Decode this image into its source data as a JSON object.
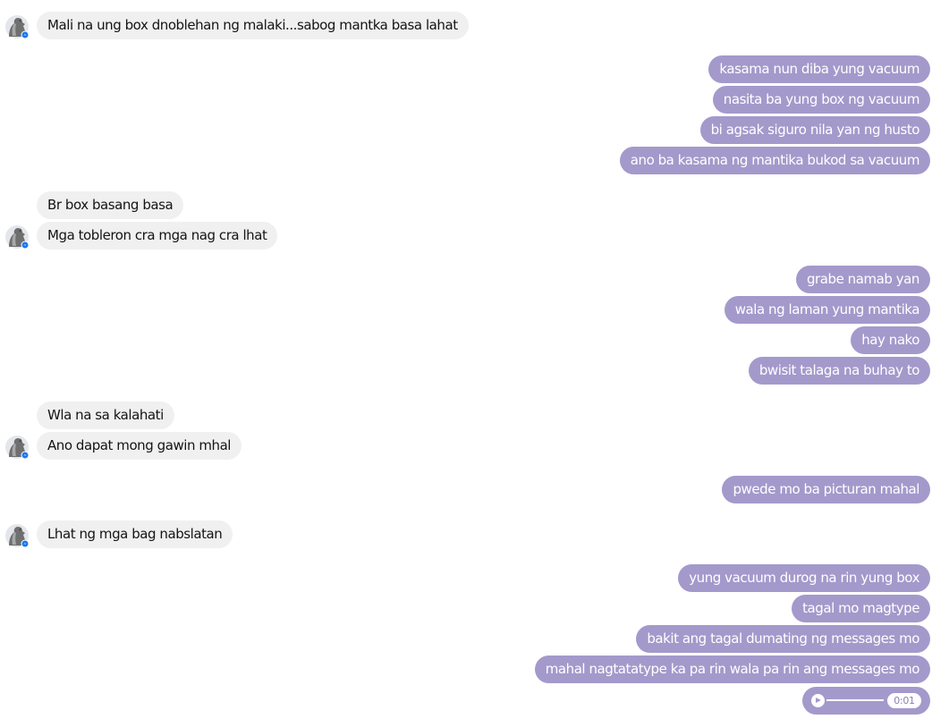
{
  "theme": {
    "incoming_bubble_color": "#f0f0f0",
    "outgoing_bubble_color": "#a499cb",
    "outgoing_text_color": "#ffffff"
  },
  "avatar_icon": "user-avatar-with-messenger-badge",
  "audio_icon": "play-icon",
  "messages": [
    {
      "dir": "in",
      "text": "Mali na ung box dnoblehan ng malaki...sabog mantka basa lahat",
      "avatar": true
    },
    {
      "dir": "out",
      "text": "kasama nun diba yung vacuum"
    },
    {
      "dir": "out",
      "text": "nasita ba yung box ng vacuum"
    },
    {
      "dir": "out",
      "text": "bi agsak siguro nila yan ng husto"
    },
    {
      "dir": "out",
      "text": "ano ba kasama ng mantika bukod sa vacuum"
    },
    {
      "dir": "in",
      "text": "Br box basang basa",
      "avatar": false
    },
    {
      "dir": "in",
      "text": "Mga tobleron cra mga nag cra lhat",
      "avatar": true
    },
    {
      "dir": "out",
      "text": "grabe namab yan"
    },
    {
      "dir": "out",
      "text": "wala ng laman yung mantika"
    },
    {
      "dir": "out",
      "text": "hay nako"
    },
    {
      "dir": "out",
      "text": "bwisit talaga na buhay to"
    },
    {
      "dir": "in",
      "text": "Wla na sa kalahati",
      "avatar": false
    },
    {
      "dir": "in",
      "text": "Ano dapat mong gawin mhal",
      "avatar": true
    },
    {
      "dir": "out",
      "text": "pwede mo ba picturan mahal"
    },
    {
      "dir": "in",
      "text": "Lhat ng mga bag nabslatan",
      "avatar": true
    },
    {
      "dir": "out",
      "text": "yung vacuum durog na rin yung box"
    },
    {
      "dir": "out",
      "text": "tagal mo magtype"
    },
    {
      "dir": "out",
      "text": "bakit ang tagal dumating ng messages mo"
    },
    {
      "dir": "out",
      "text": "mahal nagtatatype ka pa rin wala pa rin ang messages mo"
    }
  ],
  "voice_message": {
    "duration": "0:01",
    "progress": 0
  }
}
